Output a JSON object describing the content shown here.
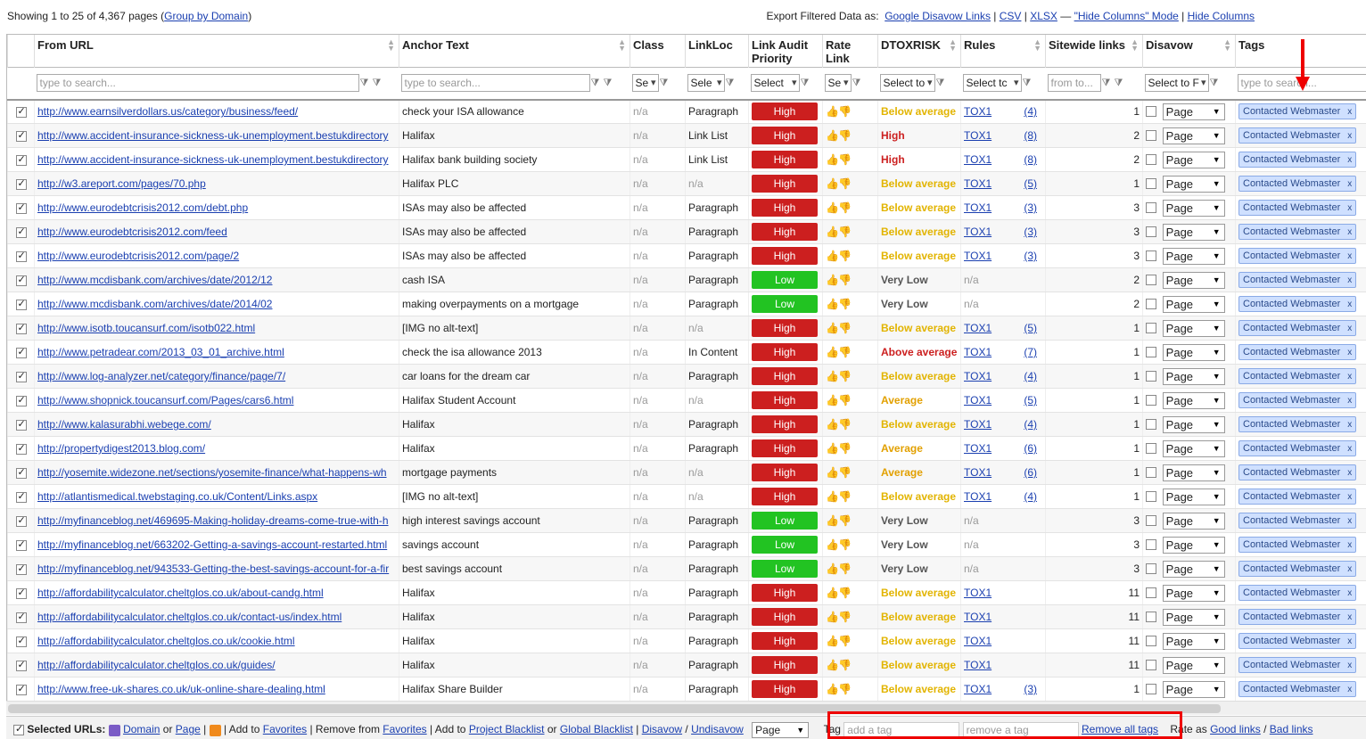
{
  "topbar": {
    "showing": "Showing 1 to 25 of 4,367 pages",
    "group_by_domain": "Group by Domain",
    "export_label": "Export Filtered Data as:",
    "google_disavow": "Google Disavow Links",
    "csv": "CSV",
    "xlsx": "XLSX",
    "hide_columns_mode": "\"Hide Columns\" Mode",
    "hide_columns": "Hide Columns"
  },
  "columns": {
    "from_url": "From URL",
    "anchor_text": "Anchor Text",
    "class": "Class",
    "linkloc": "LinkLoc",
    "priority": "Link Audit Priority",
    "rate": "Rate Link",
    "dtoxrisk": "DTOXRISK",
    "rules": "Rules",
    "sitewide": "Sitewide links",
    "disavow": "Disavow",
    "tags": "Tags"
  },
  "filters": {
    "search_placeholder": "type to search...",
    "select_short": "Se",
    "select_sele": "Sele",
    "select": "Select",
    "select_to": "Select to",
    "select_tc": "Select tc",
    "from_to": "from to...",
    "select_to_f": "Select to F",
    "tags_placeholder": "type to search..."
  },
  "rows": [
    {
      "url": "http://www.earnsilverdollars.us/category/business/feed/",
      "anchor": "check your ISA allowance",
      "cls": "n/a",
      "loc": "Paragraph",
      "priority": "High",
      "risk": "Below average",
      "rule": "TOX1",
      "rcount": "(4)",
      "sitewide": "1",
      "disavow": "Page",
      "tag": "Contacted Webmaster"
    },
    {
      "url": "http://www.accident-insurance-sickness-uk-unemployment.bestukdirectory",
      "anchor": "Halifax",
      "cls": "n/a",
      "loc": "Link List",
      "priority": "High",
      "risk": "High",
      "rule": "TOX1",
      "rcount": "(8)",
      "sitewide": "2",
      "disavow": "Page",
      "tag": "Contacted Webmaster"
    },
    {
      "url": "http://www.accident-insurance-sickness-uk-unemployment.bestukdirectory",
      "anchor": "Halifax bank building society",
      "cls": "n/a",
      "loc": "Link List",
      "priority": "High",
      "risk": "High",
      "rule": "TOX1",
      "rcount": "(8)",
      "sitewide": "2",
      "disavow": "Page",
      "tag": "Contacted Webmaster"
    },
    {
      "url": "http://w3.areport.com/pages/70.php",
      "anchor": "Halifax PLC",
      "cls": "n/a",
      "loc": "n/a",
      "priority": "High",
      "risk": "Below average",
      "rule": "TOX1",
      "rcount": "(5)",
      "sitewide": "1",
      "disavow": "Page",
      "tag": "Contacted Webmaster"
    },
    {
      "url": "http://www.eurodebtcrisis2012.com/debt.php",
      "anchor": "ISAs may also be affected",
      "cls": "n/a",
      "loc": "Paragraph",
      "priority": "High",
      "risk": "Below average",
      "rule": "TOX1",
      "rcount": "(3)",
      "sitewide": "3",
      "disavow": "Page",
      "tag": "Contacted Webmaster"
    },
    {
      "url": "http://www.eurodebtcrisis2012.com/feed",
      "anchor": "ISAs may also be affected",
      "cls": "n/a",
      "loc": "Paragraph",
      "priority": "High",
      "risk": "Below average",
      "rule": "TOX1",
      "rcount": "(3)",
      "sitewide": "3",
      "disavow": "Page",
      "tag": "Contacted Webmaster"
    },
    {
      "url": "http://www.eurodebtcrisis2012.com/page/2",
      "anchor": "ISAs may also be affected",
      "cls": "n/a",
      "loc": "Paragraph",
      "priority": "High",
      "risk": "Below average",
      "rule": "TOX1",
      "rcount": "(3)",
      "sitewide": "3",
      "disavow": "Page",
      "tag": "Contacted Webmaster"
    },
    {
      "url": "http://www.mcdisbank.com/archives/date/2012/12",
      "anchor": "cash ISA",
      "cls": "n/a",
      "loc": "Paragraph",
      "priority": "Low",
      "risk": "Very Low",
      "rule": "n/a",
      "rcount": "",
      "sitewide": "2",
      "disavow": "Page",
      "tag": "Contacted Webmaster"
    },
    {
      "url": "http://www.mcdisbank.com/archives/date/2014/02",
      "anchor": "making overpayments on a mortgage",
      "cls": "n/a",
      "loc": "Paragraph",
      "priority": "Low",
      "risk": "Very Low",
      "rule": "n/a",
      "rcount": "",
      "sitewide": "2",
      "disavow": "Page",
      "tag": "Contacted Webmaster"
    },
    {
      "url": "http://www.isotb.toucansurf.com/isotb022.html",
      "anchor": "[IMG no alt-text]",
      "cls": "n/a",
      "loc": "n/a",
      "priority": "High",
      "risk": "Below average",
      "rule": "TOX1",
      "rcount": "(5)",
      "sitewide": "1",
      "disavow": "Page",
      "tag": "Contacted Webmaster"
    },
    {
      "url": "http://www.petradear.com/2013_03_01_archive.html",
      "anchor": "check the isa allowance 2013",
      "cls": "n/a",
      "loc": "In Content",
      "priority": "High",
      "risk": "Above average",
      "rule": "TOX1",
      "rcount": "(7)",
      "sitewide": "1",
      "disavow": "Page",
      "tag": "Contacted Webmaster"
    },
    {
      "url": "http://www.log-analyzer.net/category/finance/page/7/",
      "anchor": "car loans for the dream car",
      "cls": "n/a",
      "loc": "Paragraph",
      "priority": "High",
      "risk": "Below average",
      "rule": "TOX1",
      "rcount": "(4)",
      "sitewide": "1",
      "disavow": "Page",
      "tag": "Contacted Webmaster"
    },
    {
      "url": "http://www.shopnick.toucansurf.com/Pages/cars6.html",
      "anchor": "Halifax Student Account",
      "cls": "n/a",
      "loc": "n/a",
      "priority": "High",
      "risk": "Average",
      "rule": "TOX1",
      "rcount": "(5)",
      "sitewide": "1",
      "disavow": "Page",
      "tag": "Contacted Webmaster"
    },
    {
      "url": "http://www.kalasurabhi.webege.com/",
      "anchor": "Halifax",
      "cls": "n/a",
      "loc": "Paragraph",
      "priority": "High",
      "risk": "Below average",
      "rule": "TOX1",
      "rcount": "(4)",
      "sitewide": "1",
      "disavow": "Page",
      "tag": "Contacted Webmaster"
    },
    {
      "url": "http://propertydigest2013.blog.com/",
      "anchor": "Halifax",
      "cls": "n/a",
      "loc": "Paragraph",
      "priority": "High",
      "risk": "Average",
      "rule": "TOX1",
      "rcount": "(6)",
      "sitewide": "1",
      "disavow": "Page",
      "tag": "Contacted Webmaster"
    },
    {
      "url": "http://yosemite.widezone.net/sections/yosemite-finance/what-happens-wh",
      "anchor": "mortgage payments",
      "cls": "n/a",
      "loc": "n/a",
      "priority": "High",
      "risk": "Average",
      "rule": "TOX1",
      "rcount": "(6)",
      "sitewide": "1",
      "disavow": "Page",
      "tag": "Contacted Webmaster"
    },
    {
      "url": "http://atlantismedical.twebstaging.co.uk/Content/Links.aspx",
      "anchor": "[IMG no alt-text]",
      "cls": "n/a",
      "loc": "n/a",
      "priority": "High",
      "risk": "Below average",
      "rule": "TOX1",
      "rcount": "(4)",
      "sitewide": "1",
      "disavow": "Page",
      "tag": "Contacted Webmaster"
    },
    {
      "url": "http://myfinanceblog.net/469695-Making-holiday-dreams-come-true-with-h",
      "anchor": "high interest savings account",
      "cls": "n/a",
      "loc": "Paragraph",
      "priority": "Low",
      "risk": "Very Low",
      "rule": "n/a",
      "rcount": "",
      "sitewide": "3",
      "disavow": "Page",
      "tag": "Contacted Webmaster"
    },
    {
      "url": "http://myfinanceblog.net/663202-Getting-a-savings-account-restarted.html",
      "anchor": "savings account",
      "cls": "n/a",
      "loc": "Paragraph",
      "priority": "Low",
      "risk": "Very Low",
      "rule": "n/a",
      "rcount": "",
      "sitewide": "3",
      "disavow": "Page",
      "tag": "Contacted Webmaster"
    },
    {
      "url": "http://myfinanceblog.net/943533-Getting-the-best-savings-account-for-a-fir",
      "anchor": "best savings account",
      "cls": "n/a",
      "loc": "Paragraph",
      "priority": "Low",
      "risk": "Very Low",
      "rule": "n/a",
      "rcount": "",
      "sitewide": "3",
      "disavow": "Page",
      "tag": "Contacted Webmaster"
    },
    {
      "url": "http://affordabilitycalculator.cheltglos.co.uk/about-candg.html",
      "anchor": "Halifax",
      "cls": "n/a",
      "loc": "Paragraph",
      "priority": "High",
      "risk": "Below average",
      "rule": "TOX1",
      "rcount": "",
      "sitewide": "11",
      "disavow": "Page",
      "tag": "Contacted Webmaster"
    },
    {
      "url": "http://affordabilitycalculator.cheltglos.co.uk/contact-us/index.html",
      "anchor": "Halifax",
      "cls": "n/a",
      "loc": "Paragraph",
      "priority": "High",
      "risk": "Below average",
      "rule": "TOX1",
      "rcount": "",
      "sitewide": "11",
      "disavow": "Page",
      "tag": "Contacted Webmaster"
    },
    {
      "url": "http://affordabilitycalculator.cheltglos.co.uk/cookie.html",
      "anchor": "Halifax",
      "cls": "n/a",
      "loc": "Paragraph",
      "priority": "High",
      "risk": "Below average",
      "rule": "TOX1",
      "rcount": "",
      "sitewide": "11",
      "disavow": "Page",
      "tag": "Contacted Webmaster"
    },
    {
      "url": "http://affordabilitycalculator.cheltglos.co.uk/guides/",
      "anchor": "Halifax",
      "cls": "n/a",
      "loc": "Paragraph",
      "priority": "High",
      "risk": "Below average",
      "rule": "TOX1",
      "rcount": "",
      "sitewide": "11",
      "disavow": "Page",
      "tag": "Contacted Webmaster"
    },
    {
      "url": "http://www.free-uk-shares.co.uk/uk-online-share-dealing.html",
      "anchor": "Halifax Share Builder",
      "cls": "n/a",
      "loc": "Paragraph",
      "priority": "High",
      "risk": "Below average",
      "rule": "TOX1",
      "rcount": "(3)",
      "sitewide": "1",
      "disavow": "Page",
      "tag": "Contacted Webmaster"
    }
  ],
  "bottombar": {
    "selected_urls": "Selected URLs:",
    "domain": "Domain",
    "or1": "or",
    "page": "Page",
    "add_to": "| Add to",
    "favorites": "Favorites",
    "remove_from": "| Remove from",
    "favorites2": "Favorites",
    "add_to2": "| Add to",
    "project_blacklist": "Project Blacklist",
    "or2": "or",
    "global_blacklist": "Global Blacklist",
    "disavow": "Disavow",
    "undisavow": "Undisavow",
    "page_select": "Page",
    "tag_label": "Tag",
    "add_tag_placeholder": "add a tag",
    "remove_tag_placeholder": "remove a tag",
    "remove_all_tags": "Remove all tags",
    "rate_as": "Rate as",
    "good_links": "Good links",
    "bad_links": "Bad links"
  },
  "colors": {
    "priority_high": "#cc1f1f",
    "priority_low": "#22c322",
    "tag_bg": "#cfe0ff",
    "highlight": "#ee0000"
  }
}
